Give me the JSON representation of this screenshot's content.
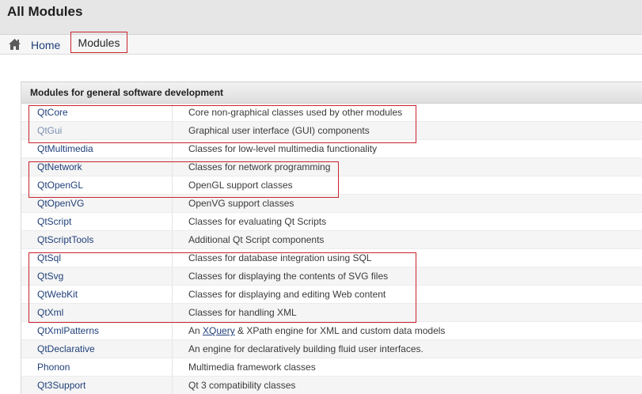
{
  "title": "All Modules",
  "breadcrumb": {
    "home_label": "Home",
    "current_label": "Modules",
    "home_icon": "home-icon"
  },
  "table": {
    "header": "Modules for general software development",
    "rows": [
      {
        "name": "QtCore",
        "desc": "Core non-graphical classes used by other modules"
      },
      {
        "name": "QtGui",
        "desc": "Graphical user interface (GUI) components"
      },
      {
        "name": "QtMultimedia",
        "desc": "Classes for low-level multimedia functionality"
      },
      {
        "name": "QtNetwork",
        "desc": "Classes for network programming"
      },
      {
        "name": "QtOpenGL",
        "desc": "OpenGL support classes"
      },
      {
        "name": "QtOpenVG",
        "desc": "OpenVG support classes"
      },
      {
        "name": "QtScript",
        "desc": "Classes for evaluating Qt Scripts"
      },
      {
        "name": "QtScriptTools",
        "desc": "Additional Qt Script components"
      },
      {
        "name": "QtSql",
        "desc": "Classes for database integration using SQL"
      },
      {
        "name": "QtSvg",
        "desc": "Classes for displaying the contents of SVG files"
      },
      {
        "name": "QtWebKit",
        "desc": "Classes for displaying and editing Web content"
      },
      {
        "name": "QtXml",
        "desc": "Classes for handling XML"
      },
      {
        "name": "QtXmlPatterns",
        "desc_pre": "An ",
        "desc_link": "XQuery",
        "desc_post": " & XPath engine for XML and custom data models"
      },
      {
        "name": "QtDeclarative",
        "desc": "An engine for declaratively building fluid user interfaces."
      },
      {
        "name": "Phonon",
        "desc": "Multimedia framework classes"
      },
      {
        "name": "Qt3Support",
        "desc": "Qt 3 compatibility classes"
      }
    ]
  },
  "colors": {
    "highlight": "#c8242c",
    "link": "#20407a",
    "visited_link": "#7a8fb3"
  }
}
